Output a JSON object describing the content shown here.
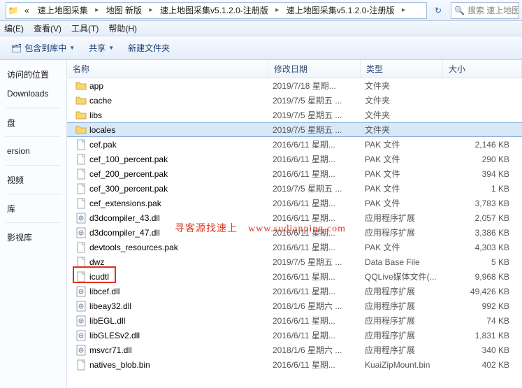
{
  "address": {
    "crumbs": [
      "«",
      "速上地图采集",
      "地图 新版",
      "速上地图采集v5.1.2.0-注册版",
      "速上地图采集v5.1.2.0-注册版"
    ],
    "search_placeholder": "搜索 速上地图"
  },
  "menu": {
    "items": [
      "编(E)",
      "查看(V)",
      "工具(T)",
      "帮助(H)"
    ]
  },
  "toolbar": {
    "include": "包含到库中",
    "share": "共享",
    "newfolder": "新建文件夹"
  },
  "sidebar": {
    "items": [
      {
        "label": "访问的位置"
      },
      {
        "label": "Downloads"
      },
      {
        "label": ""
      },
      {
        "label": "盘"
      },
      {
        "label": ""
      },
      {
        "label": "ersion"
      },
      {
        "label": ""
      },
      {
        "label": "视频"
      },
      {
        "label": ""
      },
      {
        "label": "库"
      },
      {
        "label": ""
      },
      {
        "label": "影视库"
      }
    ]
  },
  "columns": {
    "name": "名称",
    "date": "修改日期",
    "type": "类型",
    "size": "大小"
  },
  "files": [
    {
      "icon": "folder",
      "name": "app",
      "date": "2019/7/18 星期...",
      "type": "文件夹",
      "size": ""
    },
    {
      "icon": "folder",
      "name": "cache",
      "date": "2019/7/5 星期五 ...",
      "type": "文件夹",
      "size": ""
    },
    {
      "icon": "folder",
      "name": "libs",
      "date": "2019/7/5 星期五 ...",
      "type": "文件夹",
      "size": ""
    },
    {
      "icon": "folder",
      "name": "locales",
      "date": "2019/7/5 星期五 ...",
      "type": "文件夹",
      "size": "",
      "selected": true
    },
    {
      "icon": "file",
      "name": "cef.pak",
      "date": "2016/6/11 星期...",
      "type": "PAK 文件",
      "size": "2,146 KB"
    },
    {
      "icon": "file",
      "name": "cef_100_percent.pak",
      "date": "2016/6/11 星期...",
      "type": "PAK 文件",
      "size": "290 KB"
    },
    {
      "icon": "file",
      "name": "cef_200_percent.pak",
      "date": "2016/6/11 星期...",
      "type": "PAK 文件",
      "size": "394 KB"
    },
    {
      "icon": "file",
      "name": "cef_300_percent.pak",
      "date": "2019/7/5 星期五 ...",
      "type": "PAK 文件",
      "size": "1 KB"
    },
    {
      "icon": "file",
      "name": "cef_extensions.pak",
      "date": "2016/6/11 星期...",
      "type": "PAK 文件",
      "size": "3,783 KB"
    },
    {
      "icon": "dll",
      "name": "d3dcompiler_43.dll",
      "date": "2016/6/11 星期...",
      "type": "应用程序扩展",
      "size": "2,057 KB"
    },
    {
      "icon": "dll",
      "name": "d3dcompiler_47.dll",
      "date": "2016/6/11 星期...",
      "type": "应用程序扩展",
      "size": "3,386 KB"
    },
    {
      "icon": "file",
      "name": "devtools_resources.pak",
      "date": "2016/6/11 星期...",
      "type": "PAK 文件",
      "size": "4,303 KB"
    },
    {
      "icon": "file",
      "name": "dwz",
      "date": "2019/7/5 星期五 ...",
      "type": "Data Base File",
      "size": "5 KB"
    },
    {
      "icon": "file",
      "name": "icudtl",
      "date": "2016/6/11 星期...",
      "type": "QQLive媒体文件(...",
      "size": "9,968 KB"
    },
    {
      "icon": "dll",
      "name": "libcef.dll",
      "date": "2016/6/11 星期...",
      "type": "应用程序扩展",
      "size": "49,426 KB"
    },
    {
      "icon": "dll",
      "name": "libeay32.dll",
      "date": "2018/1/6 星期六 ...",
      "type": "应用程序扩展",
      "size": "992 KB"
    },
    {
      "icon": "dll",
      "name": "libEGL.dll",
      "date": "2016/6/11 星期...",
      "type": "应用程序扩展",
      "size": "74 KB"
    },
    {
      "icon": "dll",
      "name": "libGLESv2.dll",
      "date": "2016/6/11 星期...",
      "type": "应用程序扩展",
      "size": "1,831 KB"
    },
    {
      "icon": "dll",
      "name": "msvcr71.dll",
      "date": "2018/1/6 星期六 ...",
      "type": "应用程序扩展",
      "size": "340 KB"
    },
    {
      "icon": "file",
      "name": "natives_blob.bin",
      "date": "2016/6/11 星期...",
      "type": "KuaiZipMount.bin",
      "size": "402 KB"
    }
  ],
  "watermark": "寻客源找速上　www.sudianping.com"
}
